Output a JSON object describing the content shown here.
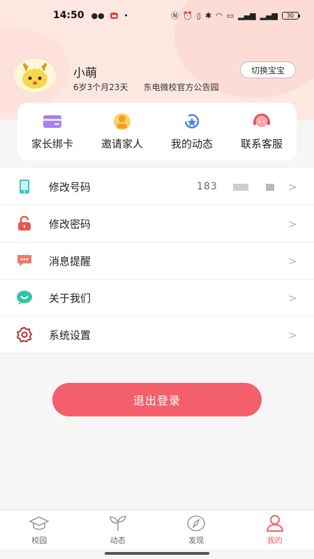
{
  "status_bar": {
    "time": "14:50",
    "battery": "30"
  },
  "profile": {
    "name": "小萌",
    "age": "6岁3个月23天",
    "school": "东电微校官方公告园",
    "switch_label": "切换宝宝"
  },
  "quick_actions": [
    {
      "label": "家长绑卡",
      "icon": "card-icon"
    },
    {
      "label": "邀请家人",
      "icon": "invite-family-icon"
    },
    {
      "label": "我的动态",
      "icon": "my-activity-icon"
    },
    {
      "label": "联系客服",
      "icon": "customer-service-icon"
    }
  ],
  "menu": [
    {
      "label": "修改号码",
      "value": "183",
      "icon": "phone-icon"
    },
    {
      "label": "修改密码",
      "value": "",
      "icon": "lock-icon"
    },
    {
      "label": "消息提醒",
      "value": "",
      "icon": "message-icon"
    },
    {
      "label": "关于我们",
      "value": "",
      "icon": "about-icon"
    },
    {
      "label": "系统设置",
      "value": "",
      "icon": "settings-icon"
    }
  ],
  "logout_label": "退出登录",
  "tabs": [
    {
      "label": "校园",
      "icon": "campus-icon",
      "active": false
    },
    {
      "label": "动态",
      "icon": "sprout-icon",
      "active": false
    },
    {
      "label": "发现",
      "icon": "compass-icon",
      "active": false
    },
    {
      "label": "我的",
      "icon": "user-icon",
      "active": true
    }
  ],
  "colors": {
    "accent": "#f3606b",
    "header_bg": "#fde7e1"
  }
}
